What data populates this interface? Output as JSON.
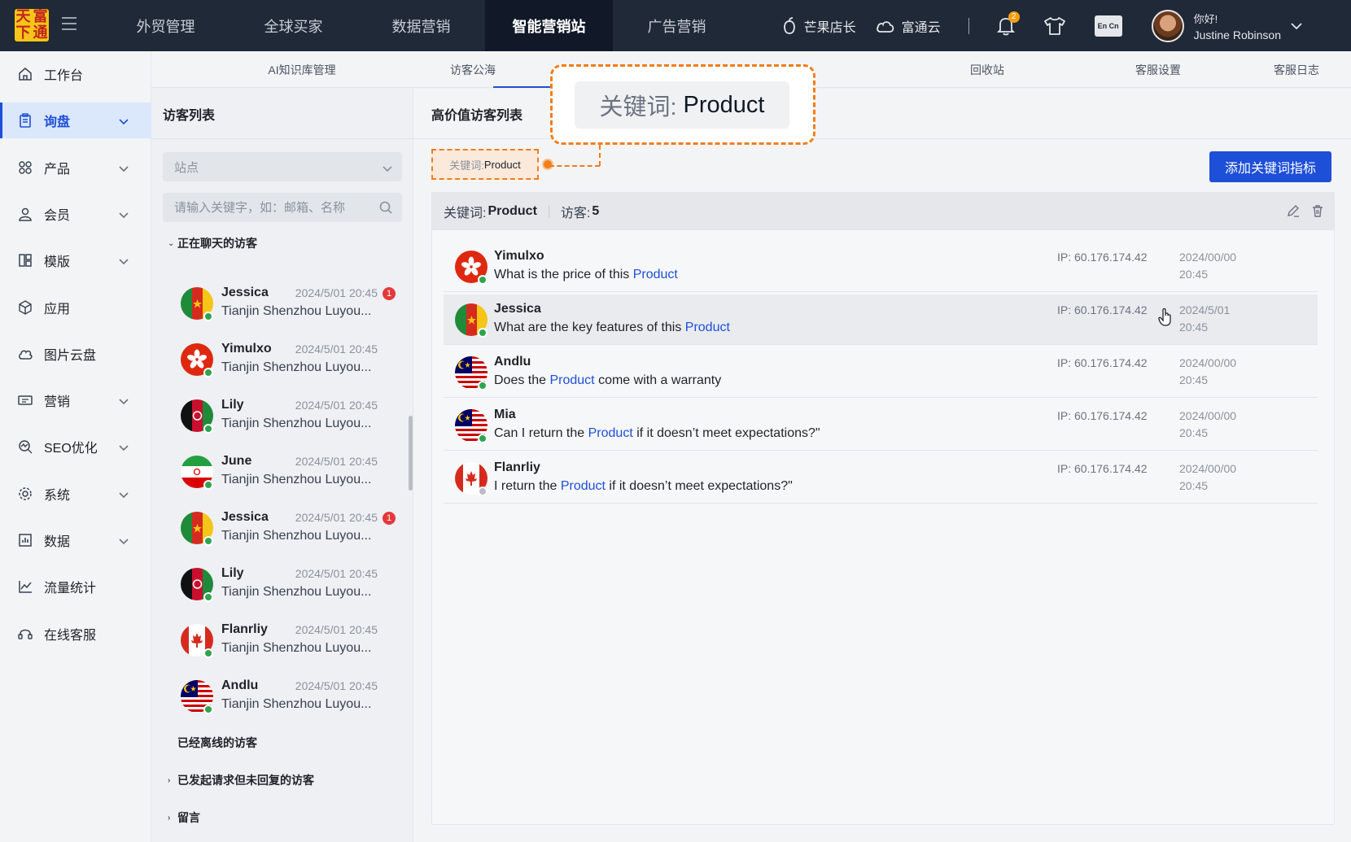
{
  "logo": {
    "chars": [
      "天",
      "富",
      "下",
      "通"
    ]
  },
  "topnav": {
    "items": [
      "外贸管理",
      "全球买家",
      "数据营销",
      "智能营销站",
      "广告营销"
    ],
    "active_index": 3
  },
  "topright": {
    "shop_label": "芒果店长",
    "cloud_label": "富通云",
    "notification_count": "2",
    "lang_label": "En Cn",
    "greeting": "你好!",
    "user_name": "Justine Robinson"
  },
  "sidebar": {
    "items": [
      {
        "label": "工作台",
        "icon": "home-icon",
        "has_chevron": false
      },
      {
        "label": "询盘",
        "icon": "clipboard-icon",
        "has_chevron": true,
        "active": true
      },
      {
        "label": "产品",
        "icon": "grid-icon",
        "has_chevron": true
      },
      {
        "label": "会员",
        "icon": "user-icon",
        "has_chevron": true
      },
      {
        "label": "模版",
        "icon": "template-icon",
        "has_chevron": true
      },
      {
        "label": "应用",
        "icon": "cube-icon",
        "has_chevron": false
      },
      {
        "label": "图片云盘",
        "icon": "cloud-icon",
        "has_chevron": false
      },
      {
        "label": "营销",
        "icon": "ticket-icon",
        "has_chevron": true
      },
      {
        "label": "SEO优化",
        "icon": "seo-icon",
        "has_chevron": true
      },
      {
        "label": "系统",
        "icon": "settings-icon",
        "has_chevron": true
      },
      {
        "label": "数据",
        "icon": "bar-chart-icon",
        "has_chevron": true
      },
      {
        "label": "流量统计",
        "icon": "line-chart-icon",
        "has_chevron": false
      },
      {
        "label": "在线客服",
        "icon": "headset-icon",
        "has_chevron": false
      }
    ]
  },
  "subtabs": {
    "items": [
      "AI知识库管理",
      "访客公海",
      "",
      "",
      "回收站",
      "客服设置",
      "客服日志"
    ],
    "active_index": 2
  },
  "visitor_list": {
    "title": "访客列表",
    "site_select": {
      "value": "站点"
    },
    "search": {
      "placeholder": "请输入关键字，如：邮箱、名称"
    },
    "groups": {
      "chatting": "正在聊天的访客",
      "offline": "已经离线的访客",
      "requested": "已发起请求但未回复的访客",
      "messages": "留言"
    },
    "visitors": [
      {
        "name": "Jessica",
        "time": "2024/5/01  20:45",
        "company": "Tianjin Shenzhou Luyou...",
        "flag": "cameroon",
        "unread": "1"
      },
      {
        "name": "Yimulxo",
        "time": "2024/5/01  20:45",
        "company": "Tianjin Shenzhou Luyou...",
        "flag": "hongkong"
      },
      {
        "name": "Lily",
        "time": "2024/5/01  20:45",
        "company": "Tianjin Shenzhou Luyou...",
        "flag": "afghanistan"
      },
      {
        "name": "June",
        "time": "2024/5/01  20:45",
        "company": "Tianjin Shenzhou Luyou...",
        "flag": "iran"
      },
      {
        "name": "Jessica",
        "time": "2024/5/01  20:45",
        "company": "Tianjin Shenzhou Luyou...",
        "flag": "cameroon",
        "unread": "1"
      },
      {
        "name": "Lily",
        "time": "2024/5/01  20:45",
        "company": "Tianjin Shenzhou Luyou...",
        "flag": "afghanistan"
      },
      {
        "name": "Flanrliy",
        "time": "2024/5/01  20:45",
        "company": "Tianjin Shenzhou Luyou...",
        "flag": "canada"
      },
      {
        "name": "Andlu",
        "time": "2024/5/01  20:45",
        "company": "Tianjin Shenzhou Luyou...",
        "flag": "malaysia"
      }
    ]
  },
  "main": {
    "title": "高价值访客列表",
    "keyword_tag": {
      "label": "关键词:",
      "value": "Product"
    },
    "add_button": "添加关键词指标",
    "panel": {
      "keyword_label": "关键词:",
      "keyword_value": "Product",
      "visitors_label": "访客:",
      "visitors_value": "5"
    },
    "rows": [
      {
        "name": "Yimulxo",
        "flag": "hongkong",
        "online": true,
        "msg_before": "What is the price of this ",
        "msg_keyword": "Product",
        "msg_after": "",
        "ip": "IP:  60.176.174.42",
        "date": "2024/00/00",
        "time": "20:45"
      },
      {
        "name": "Jessica",
        "flag": "cameroon",
        "online": true,
        "msg_before": "What are the key features of this ",
        "msg_keyword": "Product",
        "msg_after": "",
        "ip": "IP:  60.176.174.42",
        "date": "2024/5/01",
        "time": "20:45",
        "hover": true
      },
      {
        "name": "Andlu",
        "flag": "malaysia",
        "online": true,
        "msg_before": "Does the ",
        "msg_keyword": "Product",
        "msg_after": " come with a warranty",
        "ip": "IP:  60.176.174.42",
        "date": "2024/00/00",
        "time": "20:45"
      },
      {
        "name": "Mia",
        "flag": "malaysia",
        "online": true,
        "msg_before": "Can I return the ",
        "msg_keyword": "Product",
        "msg_after": " if it doesn’t meet expectations?\"",
        "ip": "IP:  60.176.174.42",
        "date": "2024/00/00",
        "time": "20:45"
      },
      {
        "name": "Flanrliy",
        "flag": "canada",
        "online": false,
        "msg_before": "I return the ",
        "msg_keyword": "Product",
        "msg_after": " if it doesn’t meet expectations?\"",
        "ip": "IP:  60.176.174.42",
        "date": "2024/00/00",
        "time": "20:45"
      }
    ]
  },
  "callout": {
    "label": "关键词:",
    "value": "Product"
  },
  "colors": {
    "accent": "#1e4fd8",
    "highlight": "#f07e1a",
    "online": "#2ea44f",
    "badge": "#e5383b"
  }
}
